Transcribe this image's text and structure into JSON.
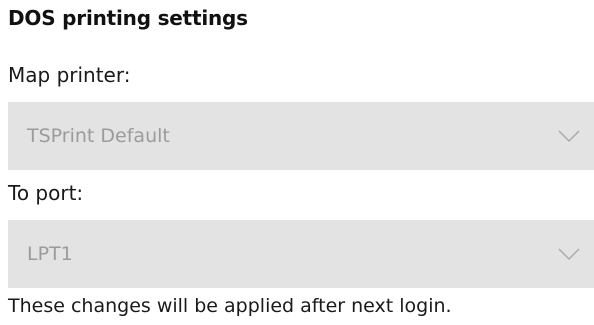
{
  "section": {
    "title": "DOS printing settings"
  },
  "map_printer": {
    "label": "Map printer:",
    "selected": "TSPrint Default"
  },
  "to_port": {
    "label": "To port:",
    "selected": "LPT1"
  },
  "note": "These changes will be applied after next login.",
  "icons": {
    "dropdown_chevron": "chevron-down-icon"
  },
  "colors": {
    "dropdown_background": "#e3e3e3",
    "disabled_text": "#9b9b9b",
    "text": "#1a1a1a"
  }
}
